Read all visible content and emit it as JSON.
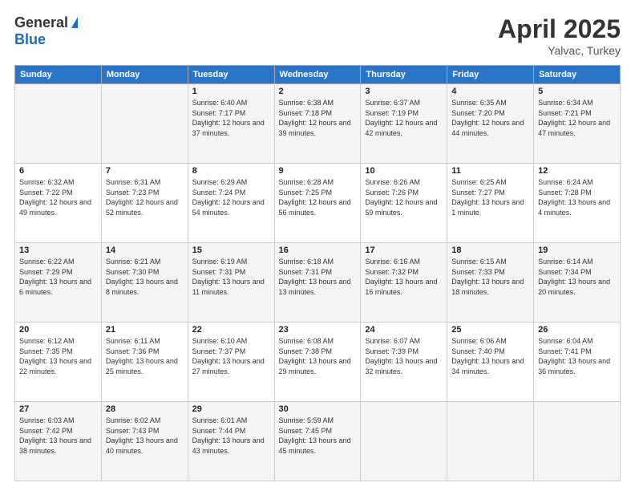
{
  "header": {
    "logo_general": "General",
    "logo_blue": "Blue",
    "title": "April 2025",
    "location": "Yalvac, Turkey"
  },
  "weekdays": [
    "Sunday",
    "Monday",
    "Tuesday",
    "Wednesday",
    "Thursday",
    "Friday",
    "Saturday"
  ],
  "weeks": [
    [
      {
        "day": "",
        "sunrise": "",
        "sunset": "",
        "daylight": ""
      },
      {
        "day": "",
        "sunrise": "",
        "sunset": "",
        "daylight": ""
      },
      {
        "day": "1",
        "sunrise": "Sunrise: 6:40 AM",
        "sunset": "Sunset: 7:17 PM",
        "daylight": "Daylight: 12 hours and 37 minutes."
      },
      {
        "day": "2",
        "sunrise": "Sunrise: 6:38 AM",
        "sunset": "Sunset: 7:18 PM",
        "daylight": "Daylight: 12 hours and 39 minutes."
      },
      {
        "day": "3",
        "sunrise": "Sunrise: 6:37 AM",
        "sunset": "Sunset: 7:19 PM",
        "daylight": "Daylight: 12 hours and 42 minutes."
      },
      {
        "day": "4",
        "sunrise": "Sunrise: 6:35 AM",
        "sunset": "Sunset: 7:20 PM",
        "daylight": "Daylight: 12 hours and 44 minutes."
      },
      {
        "day": "5",
        "sunrise": "Sunrise: 6:34 AM",
        "sunset": "Sunset: 7:21 PM",
        "daylight": "Daylight: 12 hours and 47 minutes."
      }
    ],
    [
      {
        "day": "6",
        "sunrise": "Sunrise: 6:32 AM",
        "sunset": "Sunset: 7:22 PM",
        "daylight": "Daylight: 12 hours and 49 minutes."
      },
      {
        "day": "7",
        "sunrise": "Sunrise: 6:31 AM",
        "sunset": "Sunset: 7:23 PM",
        "daylight": "Daylight: 12 hours and 52 minutes."
      },
      {
        "day": "8",
        "sunrise": "Sunrise: 6:29 AM",
        "sunset": "Sunset: 7:24 PM",
        "daylight": "Daylight: 12 hours and 54 minutes."
      },
      {
        "day": "9",
        "sunrise": "Sunrise: 6:28 AM",
        "sunset": "Sunset: 7:25 PM",
        "daylight": "Daylight: 12 hours and 56 minutes."
      },
      {
        "day": "10",
        "sunrise": "Sunrise: 6:26 AM",
        "sunset": "Sunset: 7:26 PM",
        "daylight": "Daylight: 12 hours and 59 minutes."
      },
      {
        "day": "11",
        "sunrise": "Sunrise: 6:25 AM",
        "sunset": "Sunset: 7:27 PM",
        "daylight": "Daylight: 13 hours and 1 minute."
      },
      {
        "day": "12",
        "sunrise": "Sunrise: 6:24 AM",
        "sunset": "Sunset: 7:28 PM",
        "daylight": "Daylight: 13 hours and 4 minutes."
      }
    ],
    [
      {
        "day": "13",
        "sunrise": "Sunrise: 6:22 AM",
        "sunset": "Sunset: 7:29 PM",
        "daylight": "Daylight: 13 hours and 6 minutes."
      },
      {
        "day": "14",
        "sunrise": "Sunrise: 6:21 AM",
        "sunset": "Sunset: 7:30 PM",
        "daylight": "Daylight: 13 hours and 8 minutes."
      },
      {
        "day": "15",
        "sunrise": "Sunrise: 6:19 AM",
        "sunset": "Sunset: 7:31 PM",
        "daylight": "Daylight: 13 hours and 11 minutes."
      },
      {
        "day": "16",
        "sunrise": "Sunrise: 6:18 AM",
        "sunset": "Sunset: 7:31 PM",
        "daylight": "Daylight: 13 hours and 13 minutes."
      },
      {
        "day": "17",
        "sunrise": "Sunrise: 6:16 AM",
        "sunset": "Sunset: 7:32 PM",
        "daylight": "Daylight: 13 hours and 16 minutes."
      },
      {
        "day": "18",
        "sunrise": "Sunrise: 6:15 AM",
        "sunset": "Sunset: 7:33 PM",
        "daylight": "Daylight: 13 hours and 18 minutes."
      },
      {
        "day": "19",
        "sunrise": "Sunrise: 6:14 AM",
        "sunset": "Sunset: 7:34 PM",
        "daylight": "Daylight: 13 hours and 20 minutes."
      }
    ],
    [
      {
        "day": "20",
        "sunrise": "Sunrise: 6:12 AM",
        "sunset": "Sunset: 7:35 PM",
        "daylight": "Daylight: 13 hours and 22 minutes."
      },
      {
        "day": "21",
        "sunrise": "Sunrise: 6:11 AM",
        "sunset": "Sunset: 7:36 PM",
        "daylight": "Daylight: 13 hours and 25 minutes."
      },
      {
        "day": "22",
        "sunrise": "Sunrise: 6:10 AM",
        "sunset": "Sunset: 7:37 PM",
        "daylight": "Daylight: 13 hours and 27 minutes."
      },
      {
        "day": "23",
        "sunrise": "Sunrise: 6:08 AM",
        "sunset": "Sunset: 7:38 PM",
        "daylight": "Daylight: 13 hours and 29 minutes."
      },
      {
        "day": "24",
        "sunrise": "Sunrise: 6:07 AM",
        "sunset": "Sunset: 7:39 PM",
        "daylight": "Daylight: 13 hours and 32 minutes."
      },
      {
        "day": "25",
        "sunrise": "Sunrise: 6:06 AM",
        "sunset": "Sunset: 7:40 PM",
        "daylight": "Daylight: 13 hours and 34 minutes."
      },
      {
        "day": "26",
        "sunrise": "Sunrise: 6:04 AM",
        "sunset": "Sunset: 7:41 PM",
        "daylight": "Daylight: 13 hours and 36 minutes."
      }
    ],
    [
      {
        "day": "27",
        "sunrise": "Sunrise: 6:03 AM",
        "sunset": "Sunset: 7:42 PM",
        "daylight": "Daylight: 13 hours and 38 minutes."
      },
      {
        "day": "28",
        "sunrise": "Sunrise: 6:02 AM",
        "sunset": "Sunset: 7:43 PM",
        "daylight": "Daylight: 13 hours and 40 minutes."
      },
      {
        "day": "29",
        "sunrise": "Sunrise: 6:01 AM",
        "sunset": "Sunset: 7:44 PM",
        "daylight": "Daylight: 13 hours and 43 minutes."
      },
      {
        "day": "30",
        "sunrise": "Sunrise: 5:59 AM",
        "sunset": "Sunset: 7:45 PM",
        "daylight": "Daylight: 13 hours and 45 minutes."
      },
      {
        "day": "",
        "sunrise": "",
        "sunset": "",
        "daylight": ""
      },
      {
        "day": "",
        "sunrise": "",
        "sunset": "",
        "daylight": ""
      },
      {
        "day": "",
        "sunrise": "",
        "sunset": "",
        "daylight": ""
      }
    ]
  ]
}
